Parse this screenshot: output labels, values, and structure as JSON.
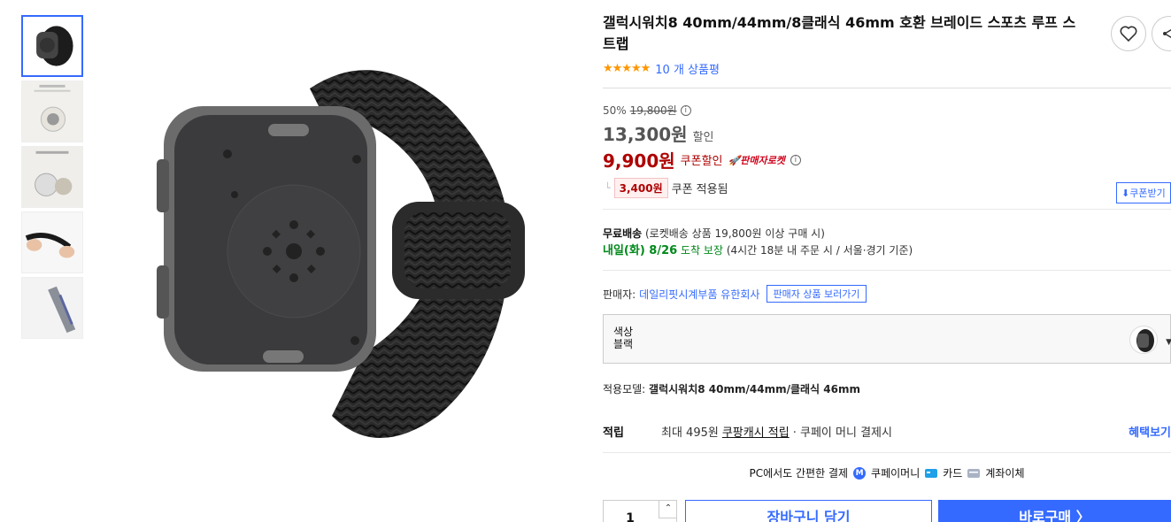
{
  "thumbnails": [
    {
      "name": "watch-back-thumb"
    },
    {
      "name": "product-detail-1-thumb"
    },
    {
      "name": "product-detail-2-thumb"
    },
    {
      "name": "hands-strap-thumb"
    },
    {
      "name": "grey-strap-thumb"
    }
  ],
  "product": {
    "title": "갤럭시워치8 40mm/44mm/8클래식 46mm 호환 브레이드 스포츠 루프 스트랩",
    "rating_stars": 4.5,
    "review_count": "10 개 상품평"
  },
  "price": {
    "discount_rate": "50%",
    "original": "19,800원",
    "sale": "13,300원",
    "sale_label": "할인",
    "coupon_price": "9,900원",
    "coupon_label": "쿠폰할인",
    "seller_rocket": "판매자로켓",
    "coupon_amount": "3,400원",
    "coupon_applied": "쿠폰 적용됨",
    "coupon_download": "쿠폰받기"
  },
  "shipping": {
    "free": "무료배송",
    "free_cond": "(로켓배송 상품 19,800원 이상 구매 시)",
    "arrival": "내일(화) 8/26",
    "arrival_suffix": "도착 보장",
    "arrival_cond": "(4시간 18분 내 주문 시 / 서울⋅경기 기준)"
  },
  "seller": {
    "label": "판매자:",
    "name": "데일리핏시계부품 유한회사",
    "go": "판매자 상품 보러가기"
  },
  "option": {
    "label": "색상",
    "value": "블랙"
  },
  "model": {
    "label": "적용모델:",
    "value": "갤럭시워치8 40mm/44mm/클래식 46mm"
  },
  "reward": {
    "label": "적립",
    "max": "최대 495원",
    "cash": "쿠팡캐시 적립",
    "suffix": "· 쿠페이 머니 결제시",
    "more": "혜택보기"
  },
  "payment": {
    "title": "PC에서도 간편한 결제",
    "methods": [
      "쿠페이머니",
      "카드",
      "계좌이체"
    ]
  },
  "purchase": {
    "quantity": "1",
    "cart": "장바구니 담기",
    "buy": "바로구매 〉"
  },
  "colors": {
    "accent": "#346aff",
    "coupon_red": "#ae0000",
    "delivery_green": "#00891a",
    "star": "#ff9600"
  }
}
